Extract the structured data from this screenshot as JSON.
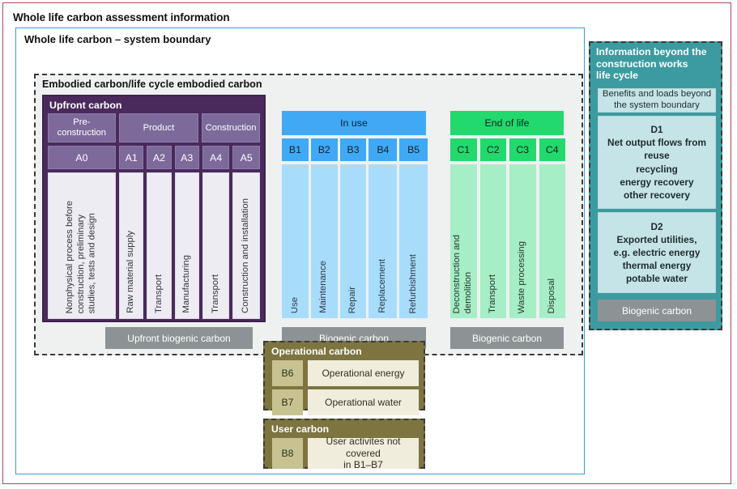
{
  "outer": {
    "title": "Whole life carbon assessment information"
  },
  "system": {
    "title": "Whole life carbon – system boundary"
  },
  "embodied": {
    "title": "Embodied carbon/life cycle embodied carbon",
    "upfront": {
      "title": "Upfront carbon",
      "phases": [
        {
          "label": "Pre-\nconstruction"
        },
        {
          "label": "Product"
        },
        {
          "label": "Construction"
        }
      ],
      "codes": [
        "A0",
        "A1",
        "A2",
        "A3",
        "A4",
        "A5"
      ],
      "modules": [
        {
          "code": "A0",
          "label": "Nonphysical process before\nconstruction, preliminary\nstudies, tests and design"
        },
        {
          "code": "A1",
          "label": "Raw material supply"
        },
        {
          "code": "A2",
          "label": "Transport"
        },
        {
          "code": "A3",
          "label": "Manufacturing"
        },
        {
          "code": "A4",
          "label": "Transport"
        },
        {
          "code": "A5",
          "label": "Construction and installation"
        }
      ]
    },
    "in_use": {
      "title": "In use",
      "codes": [
        "B1",
        "B2",
        "B3",
        "B4",
        "B5"
      ],
      "modules": [
        {
          "code": "B1",
          "label": "Use"
        },
        {
          "code": "B2",
          "label": "Maintenance"
        },
        {
          "code": "B3",
          "label": "Repair"
        },
        {
          "code": "B4",
          "label": "Replacement"
        },
        {
          "code": "B5",
          "label": "Refurbishment"
        }
      ]
    },
    "end_of_life": {
      "title": "End of life",
      "codes": [
        "C1",
        "C2",
        "C3",
        "C4"
      ],
      "modules": [
        {
          "code": "C1",
          "label": "Deconstruction and\ndemolition"
        },
        {
          "code": "C2",
          "label": "Transport"
        },
        {
          "code": "C3",
          "label": "Waste processing"
        },
        {
          "code": "C4",
          "label": "Disposal"
        }
      ]
    },
    "biogenic_bars": [
      {
        "label": "Upfront biogenic carbon"
      },
      {
        "label": "Biogenic carbon"
      },
      {
        "label": "Biogenic carbon"
      }
    ]
  },
  "operational": {
    "title": "Operational carbon",
    "rows": [
      {
        "code": "B6",
        "label": "Operational energy"
      },
      {
        "code": "B7",
        "label": "Operational water"
      }
    ]
  },
  "user_carbon": {
    "title": "User carbon",
    "rows": [
      {
        "code": "B8",
        "label": "User activites not covered\nin B1–B7"
      }
    ]
  },
  "beyond": {
    "title": "Information beyond the\nconstruction works\nlife cycle",
    "subtitle": "Benefits and loads beyond\nthe system boundary",
    "cards": [
      {
        "code": "D1",
        "label": "D1\nNet output flows from\nreuse\nrecycling\nenergy recovery\nother recovery"
      },
      {
        "code": "D2",
        "label": "D2\nExported utilities,\ne.g. electric energy\nthermal energy\npotable water"
      }
    ],
    "biogenic": "Biogenic carbon"
  },
  "colors": {
    "outer_border": "#b4455c",
    "system_border": "#3a9ad9",
    "embodied_bg": "#eff0f0",
    "purple_dark": "#4a2a5c",
    "purple_mid": "#7d6a9b",
    "purple_light": "#eeecf3",
    "blue": "#3fa9f5",
    "blue_light": "#a8dcfb",
    "green": "#22d96e",
    "green_light": "#a6eec5",
    "gray": "#8d9294",
    "olive": "#7d7440",
    "olive_code": "#c8c291",
    "olive_light": "#f0eddc",
    "teal": "#3c9ba0",
    "teal_light": "#c5e4e7"
  }
}
